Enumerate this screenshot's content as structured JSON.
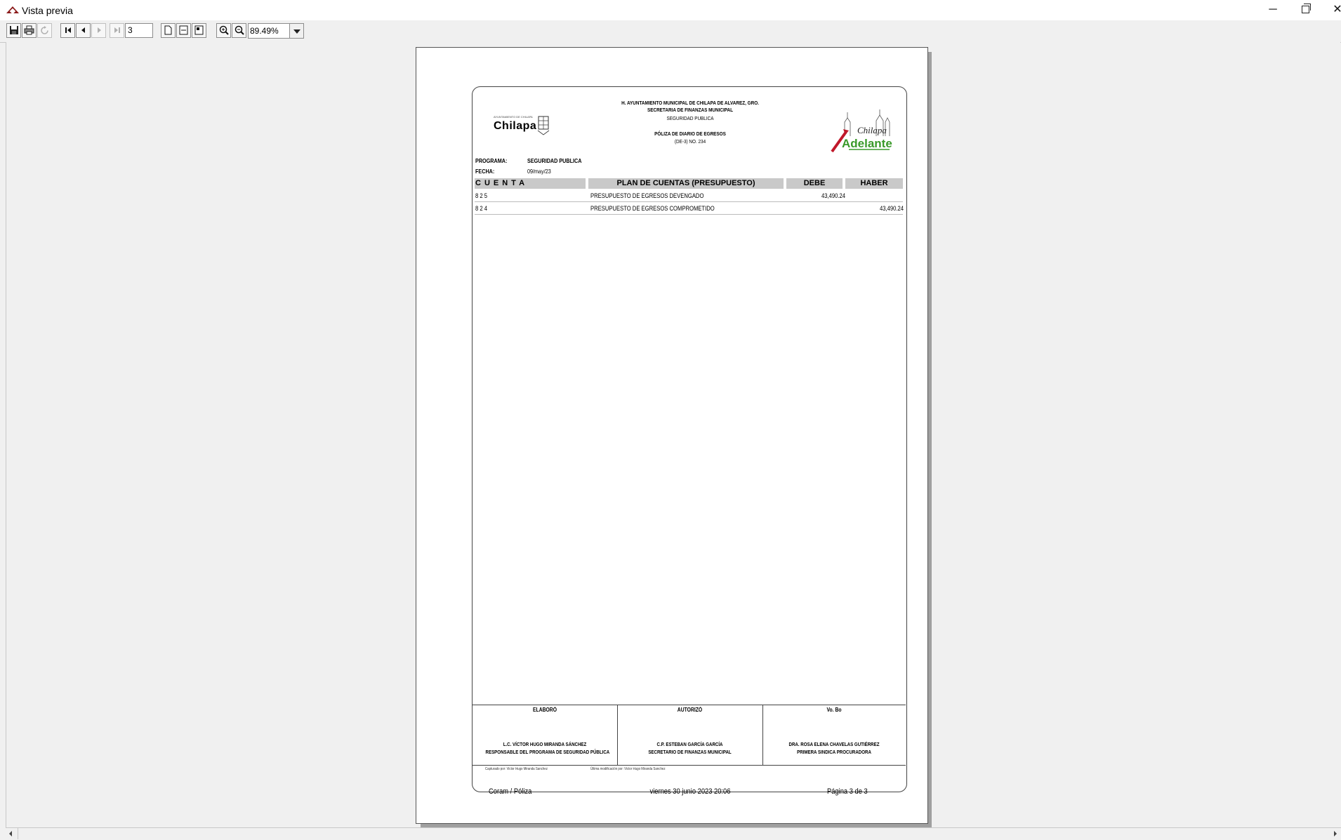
{
  "window": {
    "title": "Vista previa",
    "min": "─",
    "close": "✕"
  },
  "toolbar": {
    "page_input": "3",
    "zoom_value": "89.49%"
  },
  "header": {
    "line1": "H. AYUNTAMIENTO MUNICIPAL DE CHILAPA DE ALVAREZ, GRO.",
    "line2": "SECRETARIA DE FINANZAS MUNICIPAL",
    "line3": "SEGURIDAD PUBLICA",
    "line4": "PÓLIZA DE DIARIO DE EGRESOS",
    "line5": "(DE-3) NO. 234",
    "logo_left_small": "AYUNTAMIENTO DE CHILAPA",
    "logo_left_name": "Chilapa",
    "logo_right_top": "Chilapa",
    "logo_right_bottom": "Adelante"
  },
  "meta": {
    "programa_label": "PROGRAMA:",
    "programa_value": "SEGURIDAD PUBLICA",
    "fecha_label": "FECHA:",
    "fecha_value": "09/may/23"
  },
  "table": {
    "headers": {
      "cuenta": "CUENTA",
      "plan": "PLAN DE CUENTAS (PRESUPUESTO)",
      "debe": "DEBE",
      "haber": "HABER"
    },
    "rows": [
      {
        "cuenta": "8 2 5",
        "plan": "PRESUPUESTO DE EGRESOS DEVENGADO",
        "debe": "43,490.24",
        "haber": ""
      },
      {
        "cuenta": "8 2 4",
        "plan": "PRESUPUESTO DE EGRESOS COMPROMETIDO",
        "debe": "",
        "haber": "43,490.24"
      }
    ]
  },
  "signatures": [
    {
      "role": "ELABORÓ",
      "name": "L.C. VÍCTOR HUGO MIRANDA SÁNCHEZ",
      "position": "RESPONSABLE DEL PROGRAMA DE SEGURIDAD PÚBLICA"
    },
    {
      "role": "AUTORIZÓ",
      "name": "C.P. ESTEBAN GARCÍA GARCÍA",
      "position": "SECRETARIO DE FINANZAS MUNICIPAL"
    },
    {
      "role": "Vo. Bo",
      "name": "DRA. ROSA ELENA CHAVELAS GUTIÉRREZ",
      "position": "PRIMERA SINDICA PROCURADORA"
    }
  ],
  "capture": {
    "captured_by": "Capturado por: Victor Hugo Miranda Sanchez",
    "modified_by": "Última modificación por: Victor Hugo Miranda Sanchez"
  },
  "footer": {
    "left": "Coram / Póliza",
    "center": "viernes 30 junio 2023 20:06",
    "right": "Página 3 de 3"
  }
}
